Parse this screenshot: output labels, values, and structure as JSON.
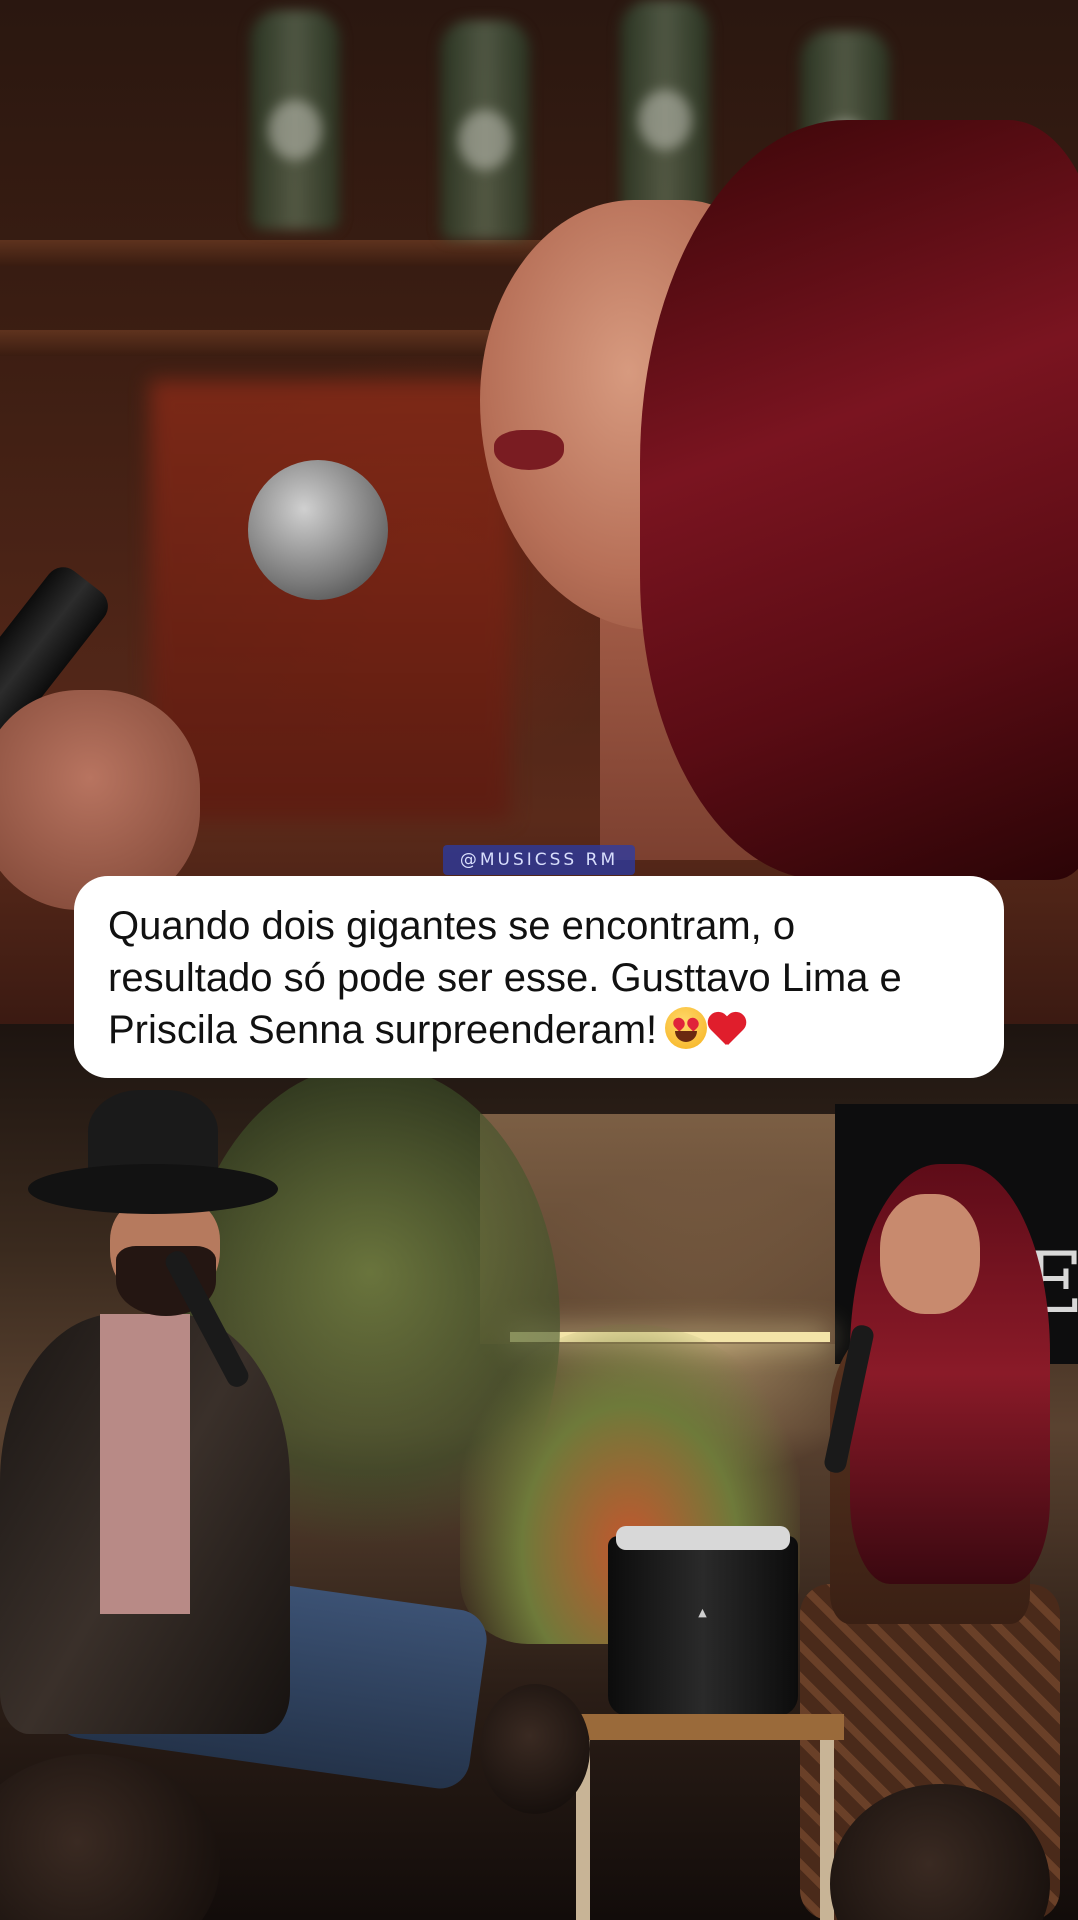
{
  "watermark": {
    "text": "@MUSICSS RM"
  },
  "caption": {
    "text": "Quando dois gigantes se encontram, o resultado só pode ser esse. Gusttavo Lima e Priscila Senna surpreenderam!",
    "emojis": [
      "smiling-face-with-heart-eyes-icon",
      "red-heart-icon"
    ]
  },
  "colors": {
    "caption_background": "#ffffff",
    "caption_text": "#111111",
    "watermark_background": "#2a3caa"
  }
}
